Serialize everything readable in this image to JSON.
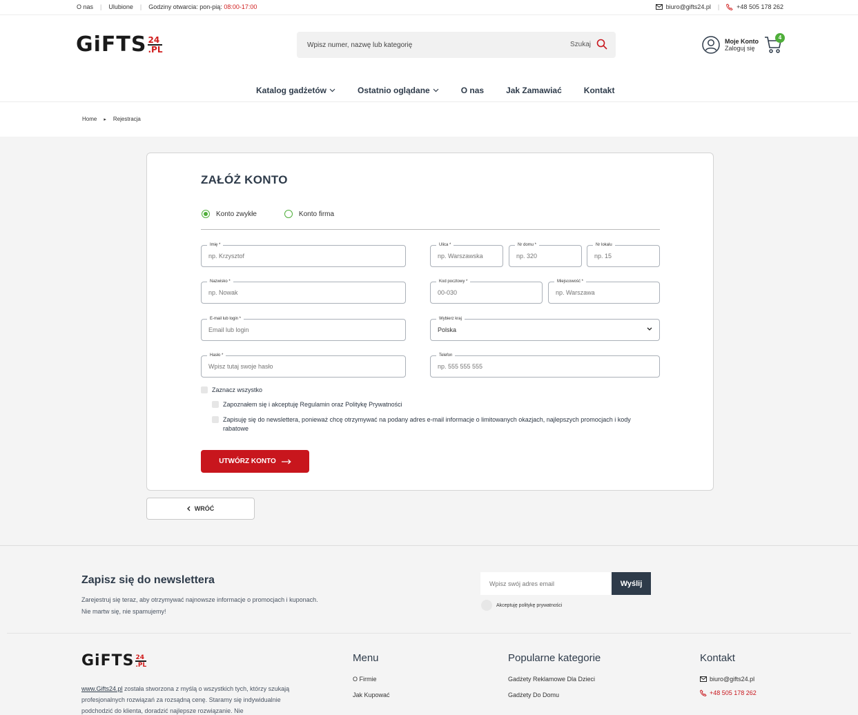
{
  "topbar": {
    "about": "O nas",
    "favorites": "Ulubione",
    "hours_label": "Godziny otwarcia: pon-pią:",
    "hours_value": "08:00-17:00",
    "email": "biuro@gifts24.pl",
    "phone": "+48 505 178 262"
  },
  "logo": {
    "main": "GiFTS",
    "num": "24",
    "tld": ".PL"
  },
  "search": {
    "placeholder": "Wpisz numer, nazwę lub kategorię",
    "button": "Szukaj"
  },
  "account": {
    "title": "Moje Konto",
    "subtitle": "Zaloguj się"
  },
  "cart": {
    "count": "4"
  },
  "nav": [
    {
      "label": "Katalog gadżetów",
      "dropdown": true
    },
    {
      "label": "Ostatnio oglądane",
      "dropdown": true
    },
    {
      "label": "O nas",
      "dropdown": false
    },
    {
      "label": "Jak Zamawiać",
      "dropdown": false
    },
    {
      "label": "Kontakt",
      "dropdown": false
    }
  ],
  "breadcrumb": {
    "home": "Home",
    "current": "Rejestracja"
  },
  "form": {
    "title": "ZAŁÓŻ KONTO",
    "account_type": {
      "personal": "Konto zwykłe",
      "company": "Konto firma",
      "selected": "personal"
    },
    "fields": {
      "first_name": {
        "label": "Imię *",
        "placeholder": "np. Krzysztof"
      },
      "last_name": {
        "label": "Nazwisko *",
        "placeholder": "np. Nowak"
      },
      "email": {
        "label": "E-mail lub login *",
        "placeholder": "Email lub login"
      },
      "password": {
        "label": "Hasło *",
        "placeholder": "Wpisz tutaj swoje hasło"
      },
      "street": {
        "label": "Ulica *",
        "placeholder": "np. Warszawska"
      },
      "house": {
        "label": "Nr domu *",
        "placeholder": "np. 320"
      },
      "apartment": {
        "label": "Nr lokalu",
        "placeholder": "np. 15"
      },
      "postcode": {
        "label": "Kod pocztowy *",
        "placeholder": "00-030"
      },
      "city": {
        "label": "Miejscowość *",
        "placeholder": "np. Warszawa"
      },
      "country": {
        "label": "Wybierz kraj",
        "value": "Polska"
      },
      "phone": {
        "label": "Telefon",
        "placeholder": "np. 555 555 555"
      }
    },
    "checks": {
      "all": "Zaznacz wszystko",
      "terms": "Zapoznałem się i akceptuję Regulamin oraz Politykę Prywatności",
      "newsletter": "Zapisuję się do newslettera, ponieważ chcę otrzymywać na podany adres e-mail informacje o limitowanych okazjach, najlepszych promocjach i kody rabatowe"
    },
    "submit": "UTWÓRZ KONTO",
    "back": "WRÓĆ"
  },
  "newsletter": {
    "title": "Zapisz się do newslettera",
    "desc1": "Zarejestruj się teraz, aby otrzymywać najnowsze informacje o promocjach i kuponach.",
    "desc2": "Nie martw się, nie spamujemy!",
    "placeholder": "Wpisz swój adres email",
    "button": "Wyślij",
    "consent": "Akceptuję politykę prywatności"
  },
  "footer": {
    "about_link": "www.Gifts24.pl",
    "about_text": " została stworzona z myślą o wszystkich tych, którzy szukają profesjonalnych rozwiązań za rozsądną cenę. Staramy się indywidualnie podchodzić do klienta, doradzić najlepsze rozwiązanie. Nie",
    "menu_title": "Menu",
    "menu_items": [
      "O Firmie",
      "Jak Kupować"
    ],
    "popular_title": "Popularne kategorie",
    "popular_items": [
      "Gadżety Reklamowe Dla Dzieci",
      "Gadżety Do Domu"
    ],
    "contact_title": "Kontakt",
    "contact_email": "biuro@gifts24.pl",
    "contact_phone": "+48 505 178 262"
  },
  "colors": {
    "accent_red": "#c8161d",
    "green": "#4fae3a",
    "navy": "#2e3b4a"
  }
}
